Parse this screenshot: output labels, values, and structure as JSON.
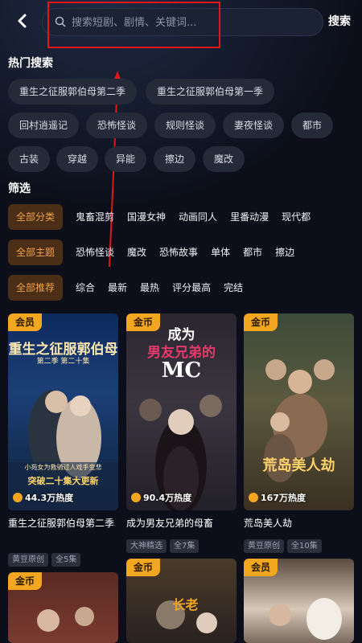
{
  "search": {
    "placeholder": "搜索短剧、剧情、关键词...",
    "button_label": "搜索"
  },
  "hot_search": {
    "title": "热门搜索",
    "items": [
      "重生之征服郭伯母第二季",
      "重生之征服郭伯母第一季",
      "回村逍遥记",
      "恐怖怪谈",
      "规则怪谈",
      "妻夜怪谈",
      "都市",
      "古装",
      "穿越",
      "异能",
      "擦边",
      "魔改"
    ]
  },
  "filters": {
    "title": "筛选",
    "rows": [
      {
        "active": "全部分类",
        "items": [
          "鬼畜混剪",
          "国漫女神",
          "动画同人",
          "里番动漫",
          "现代都"
        ]
      },
      {
        "active": "全部主题",
        "items": [
          "恐怖怪谈",
          "魔改",
          "恐怖故事",
          "单体",
          "都市",
          "擦边"
        ]
      },
      {
        "active": "全部推荐",
        "items": [
          "综合",
          "最新",
          "最热",
          "评分最高",
          "完结"
        ]
      }
    ]
  },
  "cards": [
    {
      "badge": "会员",
      "heat": "44.3万热度",
      "title": "重生之征服郭伯母第二季",
      "tags": [
        "黄豆原创",
        "全5集"
      ],
      "poster_text": "重生之征服郭伯母",
      "poster_sub": "第二季 第二十集",
      "poster_banner": "小苑女为救骑过人戏手变悲",
      "poster_bottom": "突破二十集大更新"
    },
    {
      "badge": "金币",
      "heat": "90.4万热度",
      "title": "成为男友兄弟的母畜",
      "tags": [
        "大神精选",
        "全7集"
      ],
      "poster_text_1": "成为",
      "poster_text_2": "男友兄弟的",
      "poster_text_3": "MC"
    },
    {
      "badge": "金币",
      "heat": "167万热度",
      "title": "荒岛美人劫",
      "tags": [
        "黄豆原创",
        "全10集"
      ],
      "poster_text": "荒岛美人劫"
    },
    {
      "badge": "金币"
    },
    {
      "badge": "金币",
      "poster_text": "长老"
    },
    {
      "badge": "会员"
    }
  ],
  "colors": {
    "background": "#0c0f1a",
    "accent": "#f3a720",
    "annotation_red": "#e01818"
  }
}
